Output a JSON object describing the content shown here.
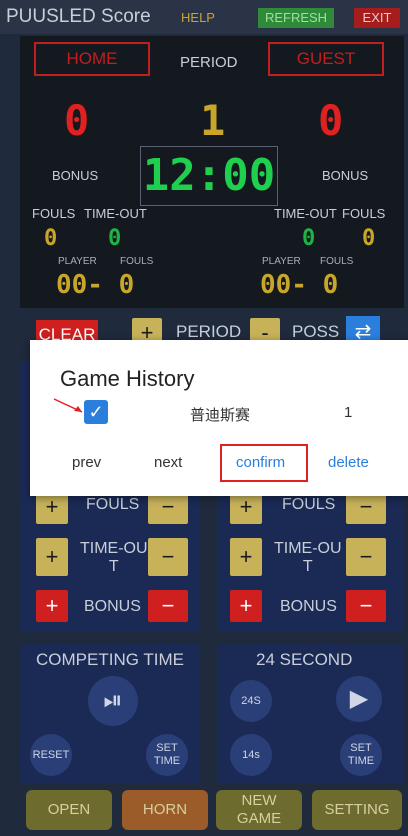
{
  "app": {
    "title": "PUUSLED Score",
    "help": "HELP",
    "refresh": "REFRESH",
    "exit": "EXIT"
  },
  "board": {
    "home": "HOME",
    "guest": "GUEST",
    "period_label": "PERIOD",
    "home_score": "0",
    "period_value": "1",
    "guest_score": "0",
    "bonus_left": "BONUS",
    "bonus_right": "BONUS",
    "timer": "12:00",
    "fouls_left": "FOULS",
    "timeout_left": "TIME-OUT",
    "timeout_right": "TIME-OUT",
    "fouls_right": "FOULS",
    "home_fouls": "0",
    "home_timeout": "0",
    "guest_timeout": "0",
    "guest_fouls": "0",
    "player_left": "PLAYER",
    "pfouls_left": "FOULS",
    "player_right": "PLAYER",
    "pfouls_right": "FOULS",
    "player_left_value": "00- 0",
    "player_right_value": "00- 0"
  },
  "controls": {
    "clear": "CLEAR",
    "plus": "+",
    "period": "PERIOD",
    "minus": "-",
    "poss": "POSS",
    "swap_icon": "⇄"
  },
  "team_panels": {
    "left": {
      "fouls": "FOULS",
      "timeout": "TIME-OU\nT",
      "bonus": "BONUS"
    },
    "right": {
      "fouls": "FOULS",
      "timeout": "TIME-OU\nT",
      "bonus": "BONUS"
    }
  },
  "competing": {
    "title": "COMPETING TIME",
    "reset": "RESET",
    "set_time": "SET\nTIME",
    "play_pause_icon": "⏯"
  },
  "shot_clock": {
    "title": "24 SECOND",
    "b24": "24S",
    "b14": "14s",
    "set_time": "SET\nTIME",
    "play_icon": "▶"
  },
  "bottom": {
    "open": "OPEN",
    "horn": "HORN",
    "new_game": "NEW\nGAME",
    "setting": "SETTING"
  },
  "modal": {
    "title": "Game History",
    "row": {
      "checked": true,
      "name": "普迪斯赛",
      "count": "1"
    },
    "prev": "prev",
    "next": "next",
    "confirm": "confirm",
    "delete": "delete"
  }
}
